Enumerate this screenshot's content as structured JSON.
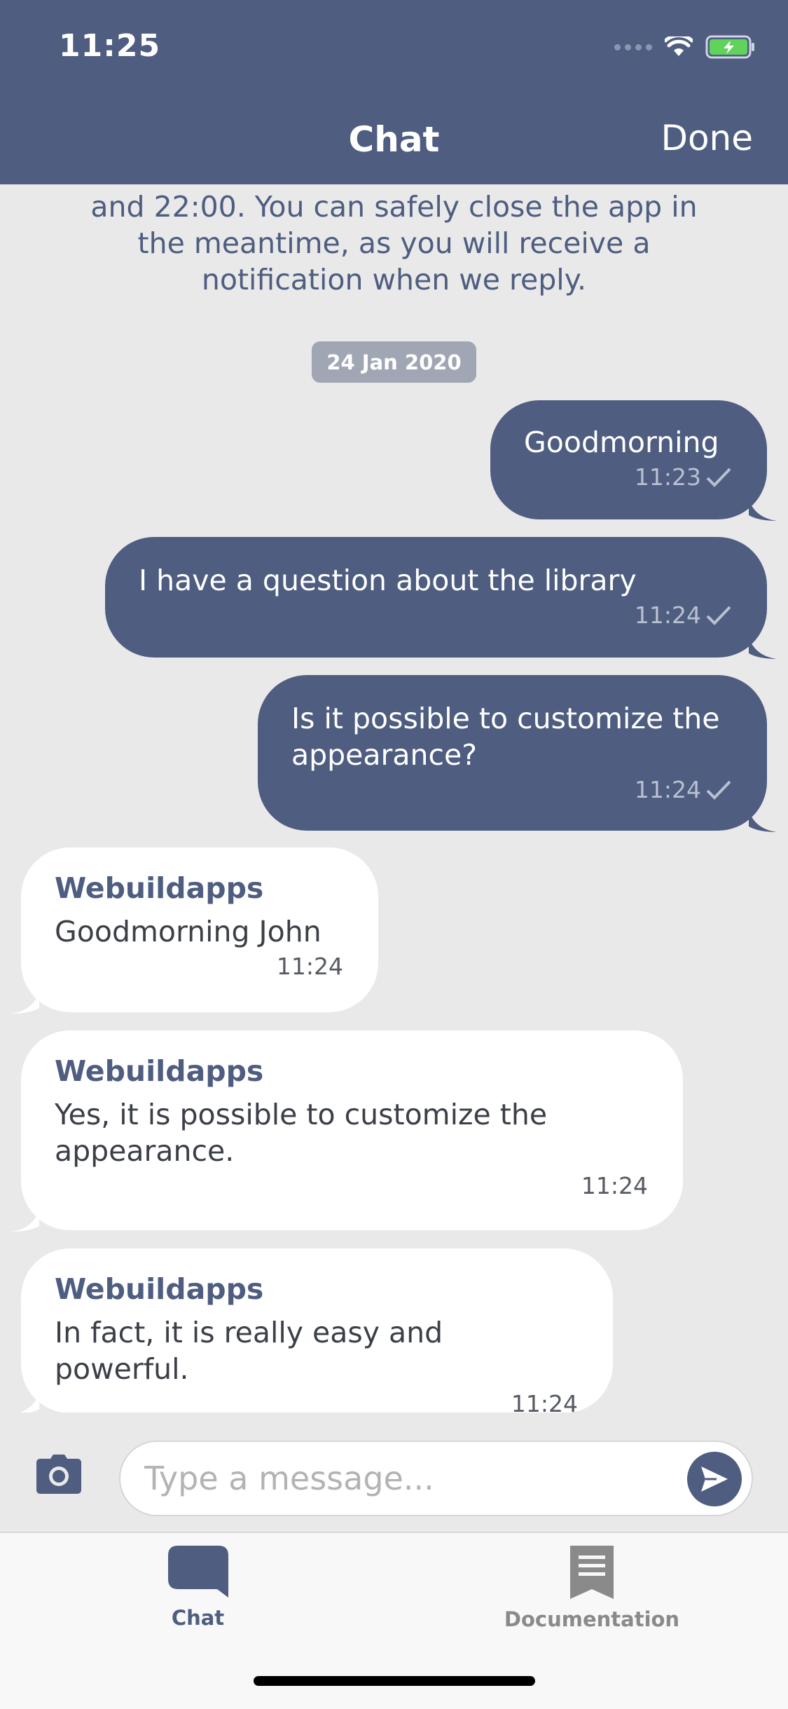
{
  "status_bar": {
    "time": "11:25"
  },
  "header": {
    "title": "Chat",
    "done_label": "Done"
  },
  "intro": {
    "text": "and 22:00. You can safely close the app in the meantime, as you will receive a notification when we reply."
  },
  "date_separator": "24 Jan 2020",
  "messages": [
    {
      "direction": "out",
      "text": "Goodmorning",
      "time": "11:23"
    },
    {
      "direction": "out",
      "text": "I have a question about the library",
      "time": "11:24"
    },
    {
      "direction": "out",
      "text": "Is it possible to customize the appearance?",
      "time": "11:24"
    },
    {
      "direction": "in",
      "sender": "Webuildapps",
      "text": "Goodmorning John",
      "time": "11:24"
    },
    {
      "direction": "in",
      "sender": "Webuildapps",
      "text": "Yes, it is possible to customize the appearance.",
      "time": "11:24"
    },
    {
      "direction": "in",
      "sender": "Webuildapps",
      "text": "In fact, it is really easy and powerful.",
      "time": "11:24"
    }
  ],
  "composer": {
    "placeholder": "Type a message..."
  },
  "tabs": [
    {
      "label": "Chat",
      "icon": "chat-bubble-icon",
      "active": true
    },
    {
      "label": "Documentation",
      "icon": "bookmark-document-icon",
      "active": false
    }
  ],
  "colors": {
    "primary": "#4e5d80",
    "background": "#e9e9e9",
    "incoming_bubble": "#ffffff",
    "date_pill": "#a0a6b4",
    "battery": "#5fd35a"
  }
}
